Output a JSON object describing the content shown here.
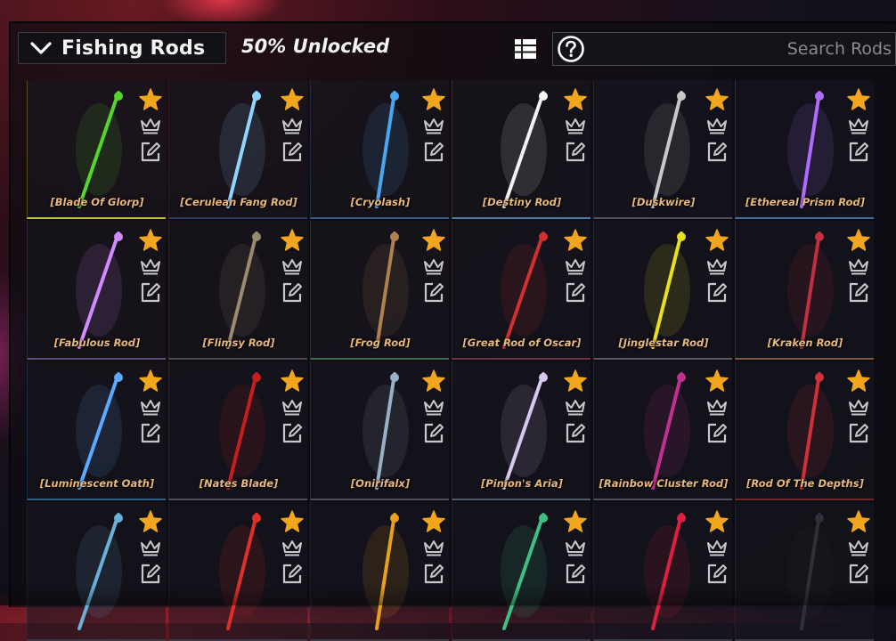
{
  "header": {
    "category": "Fishing Rods",
    "unlocked": "50% Unlocked",
    "search_placeholder": "Search Rods"
  },
  "colors": {
    "favorite_star": "#f2a61e",
    "name_text": "#e9b87a",
    "icon_gray": "#c8c8c8"
  },
  "rods": [
    {
      "name": "[Blade Of Glorp]",
      "border": "#b7c23c",
      "art": "#56d62a"
    },
    {
      "name": "[Cerulean Fang Rod]",
      "border": "#2b3a58",
      "art": "#8fd6ff"
    },
    {
      "name": "[Cryolash]",
      "border": "#2e5e88",
      "art": "#4aa8f0"
    },
    {
      "name": "[Destiny Rod]",
      "border": "#4e7aa0",
      "art": "#f4f4f4"
    },
    {
      "name": "[Duskwire]",
      "border": "#50505a",
      "art": "#c8c8c8"
    },
    {
      "name": "[Ethereal Prism Rod]",
      "border": "#3f6c9a",
      "art": "#b06cff"
    },
    {
      "name": "[Fabulous Rod]",
      "border": "#5a4f78",
      "art": "#d28bff"
    },
    {
      "name": "[Flimsy Rod]",
      "border": "#4a4a52",
      "art": "#9a8a70"
    },
    {
      "name": "[Frog Rod]",
      "border": "#3e6a50",
      "art": "#b08050"
    },
    {
      "name": "[Great Rod of Oscar]",
      "border": "#70304a",
      "art": "#d0302e"
    },
    {
      "name": "[Jinglestar Rod]",
      "border": "#5a5a60",
      "art": "#e8e020"
    },
    {
      "name": "[Kraken Rod]",
      "border": "#7a5a38",
      "art": "#c03040"
    },
    {
      "name": "[Luminescent Oath]",
      "border": "#2e5e88",
      "art": "#5aaaff"
    },
    {
      "name": "[Nates Blade]",
      "border": "#50505a",
      "art": "#c41e1e"
    },
    {
      "name": "[Onirifalx]",
      "border": "#50505a",
      "art": "#9ab0c8"
    },
    {
      "name": "[Pinion's Aria]",
      "border": "#505a6a",
      "art": "#d8c8f0"
    },
    {
      "name": "[Rainbow Cluster Rod]",
      "border": "#50505a",
      "art": "#c23090"
    },
    {
      "name": "[Rod Of The Depths]",
      "border": "#6a2a30",
      "art": "#d0303a"
    },
    {
      "name": "",
      "border": "#3a3a44",
      "art": "#6ab0d8"
    },
    {
      "name": "",
      "border": "#3a3a44",
      "art": "#e0302a"
    },
    {
      "name": "",
      "border": "#3a3a44",
      "art": "#e8a020"
    },
    {
      "name": "",
      "border": "#3a3a44",
      "art": "#40c080"
    },
    {
      "name": "",
      "border": "#3a3a44",
      "art": "#e02040"
    },
    {
      "name": "",
      "border": "#3a3a44",
      "art": "#303038"
    }
  ]
}
